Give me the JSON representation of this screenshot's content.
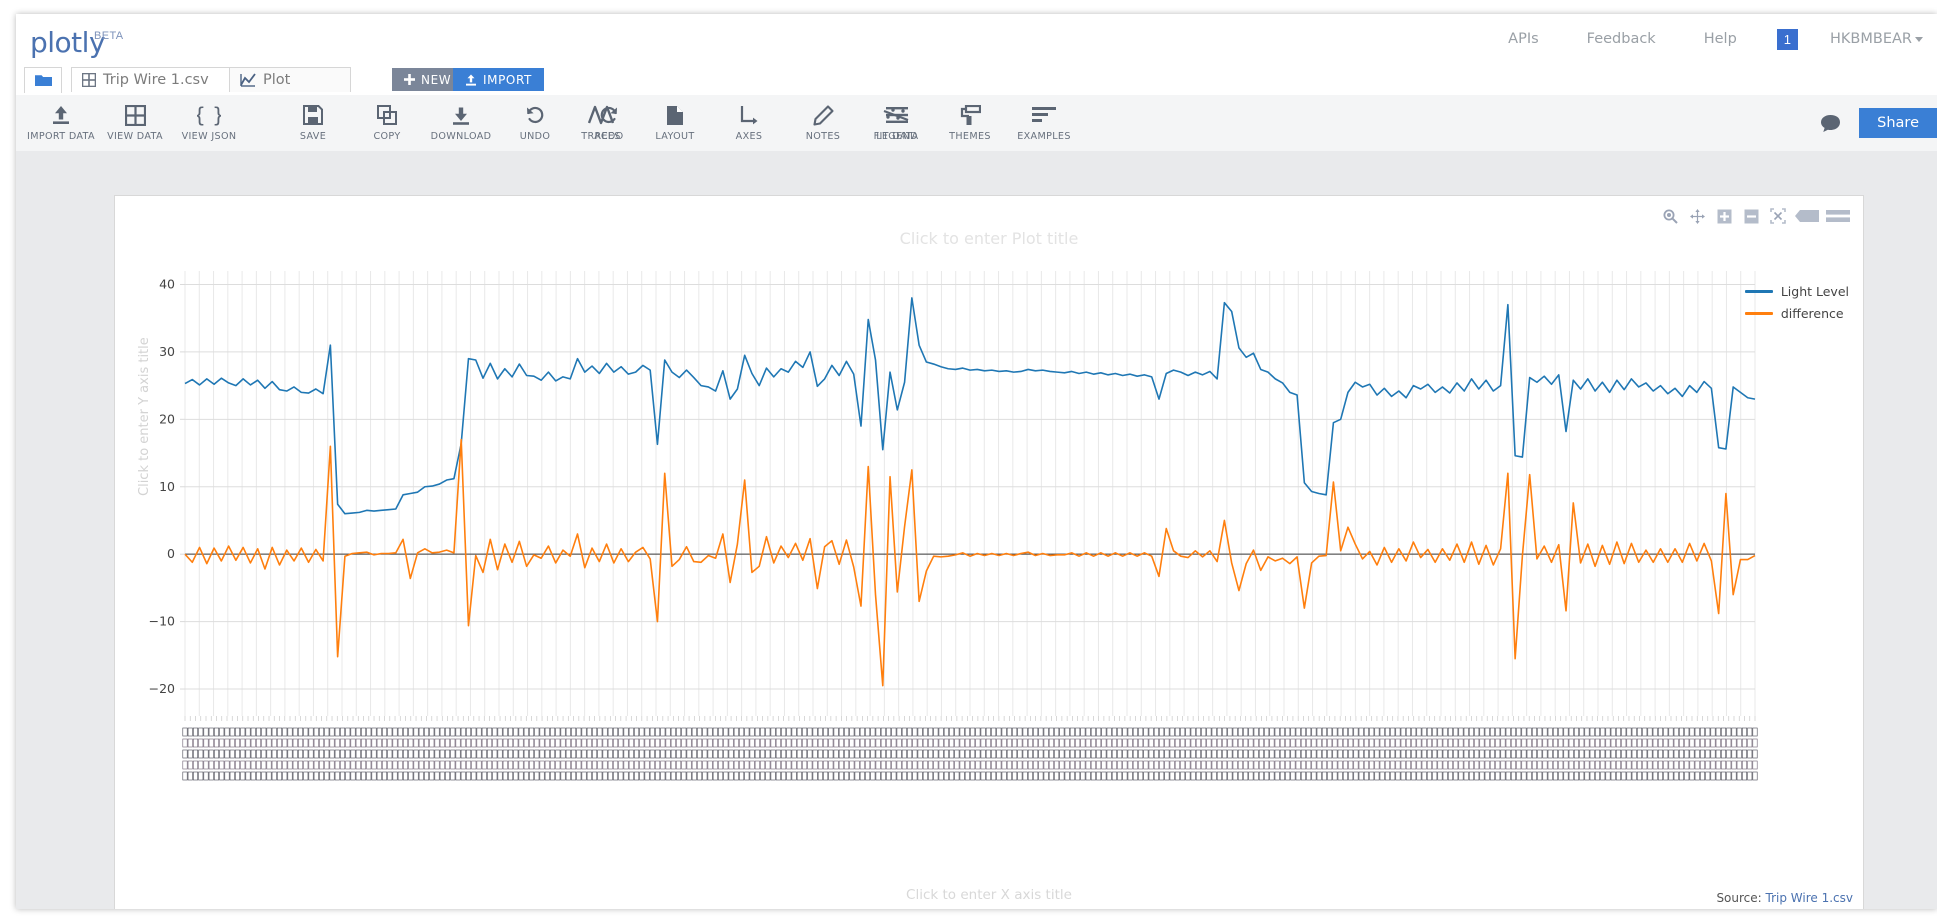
{
  "app": {
    "brand": "plotly",
    "brand_tag": "BETA"
  },
  "topnav": {
    "links": [
      {
        "label": "APIs",
        "name": "nav-apis"
      },
      {
        "label": "Feedback",
        "name": "nav-feedback"
      },
      {
        "label": "Help",
        "name": "nav-help"
      }
    ],
    "notification_count": "1",
    "username": "HKBMBEAR"
  },
  "tabs": {
    "folder_icon": "folder-icon",
    "items": [
      {
        "label": "Trip Wire 1.csv",
        "icon": "grid-icon",
        "active": false
      },
      {
        "label": "Plot",
        "icon": "line-chart-icon",
        "active": true
      }
    ],
    "new_label": "NEW",
    "import_label": "IMPORT"
  },
  "toolbar": {
    "left_group": [
      {
        "label": "IMPORT DATA",
        "icon": "upload-icon"
      },
      {
        "label": "VIEW DATA",
        "icon": "grid-icon"
      },
      {
        "label": "VIEW JSON",
        "icon": "braces-icon"
      }
    ],
    "mid_group": [
      {
        "label": "SAVE",
        "icon": "floppy-disk-icon"
      },
      {
        "label": "COPY",
        "icon": "copy-icon"
      },
      {
        "label": "DOWNLOAD",
        "icon": "download-icon"
      },
      {
        "label": "UNDO",
        "icon": "undo-arrow-icon"
      },
      {
        "label": "REDO",
        "icon": "redo-arrow-icon"
      }
    ],
    "style_group": [
      {
        "label": "TRACES",
        "icon": "zigzag-icon"
      },
      {
        "label": "LAYOUT",
        "icon": "page-icon"
      },
      {
        "label": "AXES",
        "icon": "axes-icon"
      },
      {
        "label": "NOTES",
        "icon": "pencil-icon"
      },
      {
        "label": "LEGEND",
        "icon": "hamburger-icon"
      }
    ],
    "right_group": [
      {
        "label": "FIT DATA",
        "icon": "fit-data-icon"
      },
      {
        "label": "THEMES",
        "icon": "paint-roller-icon"
      },
      {
        "label": "EXAMPLES",
        "icon": "bar-list-icon"
      }
    ],
    "comment_icon": "comment-bubble-icon",
    "share_label": "Share"
  },
  "modebar": {
    "buttons": [
      {
        "name": "zoom-icon",
        "label": "Zoom"
      },
      {
        "name": "pan-icon",
        "label": "Pan"
      },
      {
        "name": "zoom-in-icon",
        "label": "Zoom in"
      },
      {
        "name": "zoom-out-icon",
        "label": "Zoom out"
      },
      {
        "name": "autoscale-icon",
        "label": "Autoscale"
      },
      {
        "name": "hover-compare-icon",
        "label": "Compare data on hover"
      },
      {
        "name": "hover-closest-icon",
        "label": "Show closest data on hover"
      }
    ]
  },
  "plot": {
    "title_placeholder": "Click to enter Plot title",
    "y_axis_title_placeholder": "Click to enter Y axis title",
    "x_axis_title_placeholder": "Click to enter X axis title",
    "source_prefix": "Source:",
    "source_file": "Trip Wire 1.csv"
  },
  "chart_data": {
    "type": "line",
    "title": "",
    "xlabel": "",
    "ylabel": "",
    "ylim": [
      -24,
      42
    ],
    "yticks": [
      40,
      30,
      20,
      10,
      0,
      -10,
      -20
    ],
    "ytick_labels": [
      "40",
      "30",
      "20",
      "10",
      "0",
      "−10",
      "−20"
    ],
    "grid": true,
    "zeroline": true,
    "legend_position": "right",
    "xtick_labels_rotated": true,
    "xtick_labels_note": "dense rotated timestamp labels, illegible at this zoom",
    "colors": {
      "Light Level": "#1f77b4",
      "difference": "#ff7f0e"
    },
    "series": [
      {
        "name": "Light Level",
        "color": "#1f77b4",
        "values": [
          25.3,
          25.9,
          25.1,
          26.0,
          25.2,
          26.1,
          25.4,
          25.0,
          26.0,
          25.1,
          25.8,
          24.6,
          25.6,
          24.4,
          24.2,
          24.8,
          24.0,
          23.9,
          24.5,
          23.8,
          31.0,
          7.4,
          6.0,
          6.1,
          6.2,
          6.5,
          6.4,
          6.5,
          6.6,
          6.7,
          8.8,
          9.0,
          9.2,
          10.0,
          10.1,
          10.4,
          11.0,
          11.2,
          16.4,
          29.0,
          28.8,
          26.1,
          28.3,
          26.0,
          27.5,
          26.3,
          28.2,
          26.5,
          26.4,
          25.8,
          27.0,
          25.7,
          26.3,
          26.0,
          29.0,
          27.0,
          27.9,
          26.8,
          28.3,
          27.0,
          27.8,
          26.7,
          27.0,
          28.0,
          27.3,
          16.3,
          28.8,
          27.0,
          26.2,
          27.3,
          26.2,
          25.0,
          24.8,
          24.2,
          27.2,
          23.0,
          24.5,
          29.5,
          26.8,
          25.0,
          27.6,
          26.3,
          27.5,
          27.0,
          28.6,
          27.7,
          30.0,
          24.9,
          26.0,
          28.0,
          26.5,
          28.6,
          26.7,
          19.0,
          34.8,
          28.8,
          15.5,
          27.0,
          21.4,
          25.5,
          38.0,
          31.0,
          28.5,
          28.2,
          27.8,
          27.5,
          27.4,
          27.6,
          27.3,
          27.4,
          27.2,
          27.3,
          27.1,
          27.2,
          27.0,
          27.1,
          27.4,
          27.2,
          27.3,
          27.1,
          27.0,
          26.9,
          27.1,
          26.8,
          27.0,
          26.7,
          26.9,
          26.6,
          26.8,
          26.5,
          26.7,
          26.4,
          26.6,
          26.3,
          23.0,
          26.8,
          27.3,
          27.0,
          26.5,
          27.0,
          26.6,
          27.1,
          26.0,
          37.3,
          36.0,
          30.6,
          29.2,
          29.8,
          27.4,
          27.0,
          26.0,
          25.4,
          24.0,
          23.6,
          10.6,
          9.3,
          9.0,
          8.8,
          19.5,
          20.0,
          24.0,
          25.5,
          24.8,
          25.2,
          23.6,
          24.6,
          23.4,
          24.2,
          23.2,
          25.0,
          24.5,
          25.2,
          24.0,
          24.8,
          23.9,
          25.4,
          24.2,
          26.0,
          24.5,
          25.8,
          24.2,
          25.0,
          37.0,
          14.6,
          14.4,
          26.2,
          25.5,
          26.4,
          25.2,
          26.6,
          18.2,
          25.8,
          24.5,
          26.0,
          24.2,
          25.5,
          24.0,
          25.8,
          24.4,
          26.0,
          24.8,
          25.4,
          24.2,
          25.0,
          23.8,
          24.6,
          23.4,
          25.0,
          24.0,
          25.6,
          24.6,
          15.8,
          15.6,
          24.8,
          24.0,
          23.2,
          23.0
        ]
      },
      {
        "name": "difference",
        "color": "#ff7f0e",
        "values": [
          0.0,
          -1.2,
          1.0,
          -1.4,
          0.9,
          -1.0,
          1.2,
          -0.9,
          1.0,
          -1.3,
          0.8,
          -2.2,
          1.0,
          -1.6,
          0.6,
          -1.0,
          0.9,
          -1.2,
          0.7,
          -1.0,
          16.0,
          -15.2,
          -0.3,
          0.1,
          0.2,
          0.3,
          -0.1,
          0.1,
          0.1,
          0.2,
          2.2,
          -3.6,
          0.2,
          0.8,
          0.2,
          0.3,
          0.6,
          0.2,
          17.0,
          -10.6,
          -0.2,
          -2.7,
          2.2,
          -2.3,
          1.5,
          -1.2,
          1.9,
          -1.8,
          -0.1,
          -0.6,
          1.2,
          -1.3,
          0.6,
          -0.3,
          3.0,
          -2.0,
          0.9,
          -1.1,
          1.5,
          -1.3,
          0.8,
          -1.1,
          0.3,
          1.0,
          -0.7,
          -10.0,
          12.0,
          -1.8,
          -0.8,
          1.1,
          -1.1,
          -1.2,
          -0.2,
          -0.6,
          3.0,
          -4.2,
          1.5,
          11.0,
          -2.7,
          -1.8,
          2.6,
          -1.3,
          1.2,
          -0.5,
          1.6,
          -0.9,
          2.3,
          -5.1,
          1.1,
          2.0,
          -1.5,
          2.1,
          -1.9,
          -7.7,
          13.0,
          -6.0,
          -19.5,
          11.5,
          -5.6,
          4.1,
          12.5,
          -7.0,
          -2.5,
          -0.3,
          -0.4,
          -0.3,
          -0.1,
          0.2,
          -0.3,
          0.1,
          -0.2,
          0.1,
          -0.2,
          0.1,
          -0.2,
          0.1,
          0.3,
          -0.2,
          0.1,
          -0.2,
          -0.1,
          -0.1,
          0.2,
          -0.3,
          0.2,
          -0.3,
          0.2,
          -0.3,
          0.2,
          -0.3,
          0.2,
          -0.3,
          0.2,
          -0.3,
          -3.3,
          3.8,
          0.5,
          -0.3,
          -0.5,
          0.5,
          -0.4,
          0.5,
          -1.1,
          5.0,
          -1.3,
          -5.4,
          -1.4,
          0.6,
          -2.4,
          -0.4,
          -1.0,
          -0.6,
          -1.4,
          -0.4,
          -8.0,
          -1.3,
          -0.3,
          -0.2,
          10.7,
          0.5,
          4.0,
          1.5,
          -0.7,
          0.4,
          -1.6,
          1.0,
          -1.2,
          0.8,
          -1.0,
          1.8,
          -0.5,
          0.7,
          -1.2,
          0.8,
          -0.9,
          1.5,
          -1.2,
          1.8,
          -1.5,
          1.3,
          -1.6,
          0.8,
          12.0,
          -15.5,
          -0.2,
          11.8,
          -0.7,
          1.2,
          -1.2,
          1.4,
          -8.4,
          7.6,
          -1.3,
          1.5,
          -1.8,
          1.3,
          -1.5,
          1.8,
          -1.4,
          1.6,
          -1.2,
          0.6,
          -1.2,
          0.8,
          -1.2,
          0.8,
          -1.2,
          1.6,
          -1.0,
          1.6,
          -1.0,
          -8.8,
          9.0,
          -6.0,
          -0.8,
          -0.8,
          -0.2
        ]
      }
    ]
  }
}
